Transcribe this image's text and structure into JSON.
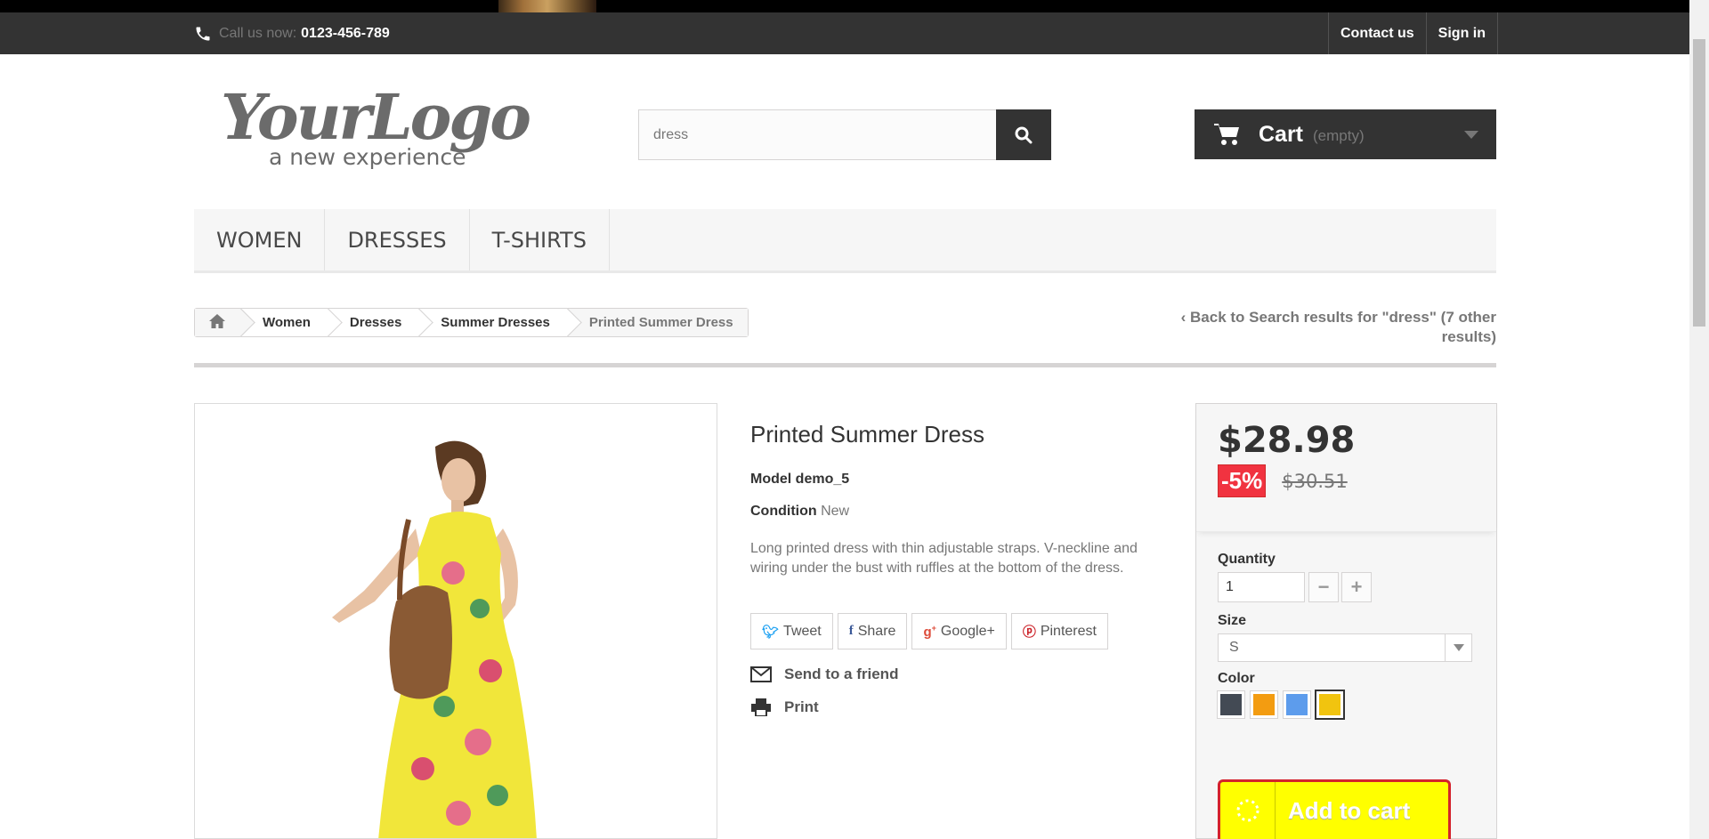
{
  "header": {
    "call_label": "Call us now:",
    "phone": "0123-456-789",
    "contact_label": "Contact us",
    "signin_label": "Sign in"
  },
  "logo": {
    "title": "YourLogo",
    "tagline": "a new experience"
  },
  "search": {
    "value": "dress"
  },
  "cart": {
    "label": "Cart",
    "status": "(empty)"
  },
  "menu": {
    "items": [
      "WOMEN",
      "DRESSES",
      "T-SHIRTS"
    ]
  },
  "breadcrumb": {
    "items": [
      "Women",
      "Dresses",
      "Summer Dresses"
    ],
    "current": "Printed Summer Dress"
  },
  "back_link": "Back to Search results for \"dress\" (7 other results)",
  "product": {
    "title": "Printed Summer Dress",
    "model_label": "Model",
    "model": "demo_5",
    "condition_label": "Condition",
    "condition": "New",
    "description": "Long printed dress with thin adjustable straps. V-neckline and wiring under the bust with ruffles at the bottom of the dress.",
    "social": [
      "Tweet",
      "Share",
      "Google+",
      "Pinterest"
    ],
    "send_to_friend": "Send to a friend",
    "print": "Print"
  },
  "buy": {
    "price": "$28.98",
    "discount": "-5%",
    "old_price": "$30.51",
    "quantity_label": "Quantity",
    "quantity": "1",
    "size_label": "Size",
    "size": "S",
    "color_label": "Color",
    "colors": [
      "#434a54",
      "#f39c11",
      "#5d9cec",
      "#f1c40f"
    ],
    "selected_color": "#f1c40f",
    "add_to_cart": "Add to cart"
  }
}
